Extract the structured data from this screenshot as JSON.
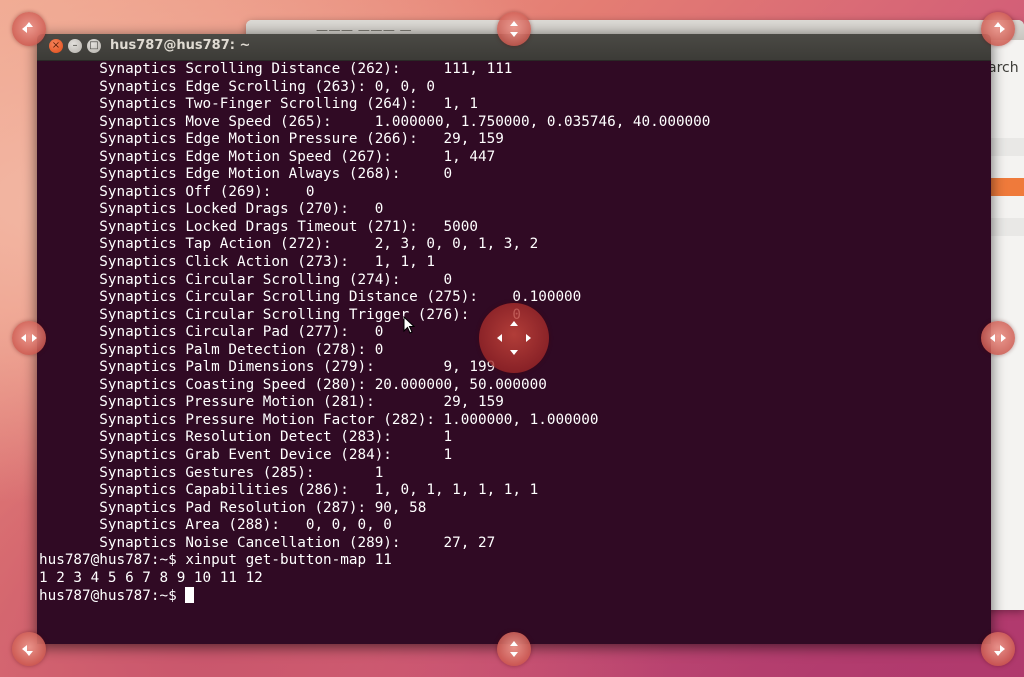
{
  "background_window": {
    "title": "——— ——— —",
    "search_text": "arch"
  },
  "terminal": {
    "title": "hus787@hus787: ~",
    "close_glyph": "×",
    "min_glyph": "–",
    "max_glyph": "□",
    "lines": [
      "       Synaptics Scrolling Distance (262):     111, 111",
      "       Synaptics Edge Scrolling (263): 0, 0, 0",
      "       Synaptics Two-Finger Scrolling (264):   1, 1",
      "       Synaptics Move Speed (265):     1.000000, 1.750000, 0.035746, 40.000000",
      "       Synaptics Edge Motion Pressure (266):   29, 159",
      "       Synaptics Edge Motion Speed (267):      1, 447",
      "       Synaptics Edge Motion Always (268):     0",
      "       Synaptics Off (269):    0",
      "       Synaptics Locked Drags (270):   0",
      "       Synaptics Locked Drags Timeout (271):   5000",
      "       Synaptics Tap Action (272):     2, 3, 0, 0, 1, 3, 2",
      "       Synaptics Click Action (273):   1, 1, 1",
      "       Synaptics Circular Scrolling (274):     0",
      "       Synaptics Circular Scrolling Distance (275):    0.100000",
      "       Synaptics Circular Scrolling Trigger (276):     0",
      "       Synaptics Circular Pad (277):   0",
      "       Synaptics Palm Detection (278): 0",
      "       Synaptics Palm Dimensions (279):        9, 199",
      "       Synaptics Coasting Speed (280): 20.000000, 50.000000",
      "       Synaptics Pressure Motion (281):        29, 159",
      "       Synaptics Pressure Motion Factor (282): 1.000000, 1.000000",
      "       Synaptics Resolution Detect (283):      1",
      "       Synaptics Grab Event Device (284):      1",
      "       Synaptics Gestures (285):       1",
      "       Synaptics Capabilities (286):   1, 0, 1, 1, 1, 1, 1",
      "       Synaptics Pad Resolution (287): 90, 58",
      "       Synaptics Area (288):   0, 0, 0, 0",
      "       Synaptics Noise Cancellation (289):     27, 27",
      "hus787@hus787:~$ xinput get-button-map 11",
      "1 2 3 4 5 6 7 8 9 10 11 12"
    ],
    "prompt": "hus787@hus787:~$ "
  },
  "colors": {
    "terminal_bg": "#300a24",
    "titlebar": "#3c3b37",
    "close_button": "#df4a16",
    "accent_orange": "#ef7a3b"
  },
  "icons": [
    "close-icon",
    "minimize-icon",
    "maximize-icon",
    "mouse-pointer-icon",
    "resize-handle-icon",
    "move-handle-icon"
  ]
}
